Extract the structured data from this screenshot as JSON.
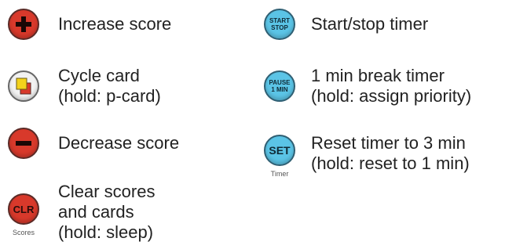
{
  "left": [
    {
      "id": "increase",
      "label_lines": [
        "Increase score"
      ],
      "icon": "plus-icon"
    },
    {
      "id": "cycle",
      "label_lines": [
        "Cycle card",
        "(hold: p-card)"
      ],
      "icon": "cards-icon"
    },
    {
      "id": "decrease",
      "label_lines": [
        "Decrease score"
      ],
      "icon": "minus-icon"
    },
    {
      "id": "clear",
      "label_lines": [
        "Clear scores",
        "and cards",
        "(hold: sleep)"
      ],
      "button_text": "CLR",
      "caption": "Scores"
    }
  ],
  "right": [
    {
      "id": "startstop",
      "label_lines": [
        "Start/stop timer"
      ],
      "button_text_lines": [
        "START",
        "STOP"
      ]
    },
    {
      "id": "pause",
      "label_lines": [
        "1 min break timer",
        "(hold: assign priority)"
      ],
      "button_text_lines": [
        "PAUSE",
        "1 MIN"
      ]
    },
    {
      "id": "set",
      "label_lines": [
        "Reset timer to 3 min",
        "(hold: reset to 1 min)"
      ],
      "button_text": "SET",
      "caption": "Timer"
    }
  ],
  "colors": {
    "red": "#d8392b",
    "blue": "#5bc4e6",
    "yellow": "#f3d21c"
  }
}
